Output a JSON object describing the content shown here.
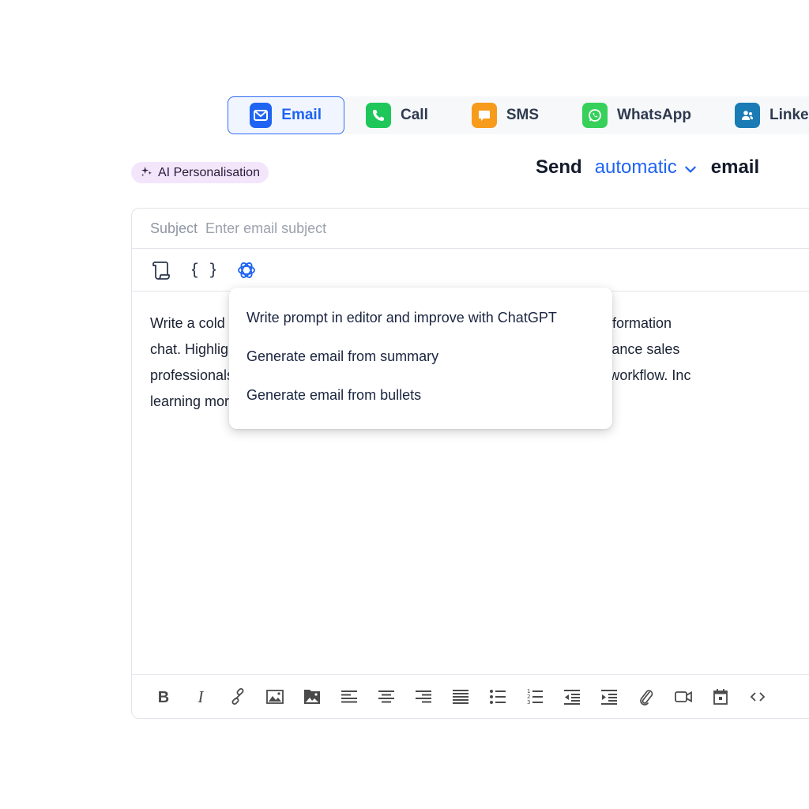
{
  "channels": {
    "tabs": [
      {
        "label": "Email",
        "icon": "mail-icon",
        "color": "#1f63f3",
        "active": true
      },
      {
        "label": "Call",
        "icon": "phone-icon",
        "color": "#1fc75b",
        "active": false
      },
      {
        "label": "SMS",
        "icon": "chat-bubble-icon",
        "color": "#f79b1c",
        "active": false
      },
      {
        "label": "WhatsApp",
        "icon": "whatsapp-icon",
        "color": "#36d05a",
        "active": false
      },
      {
        "label": "Linke",
        "icon": "users-icon",
        "color": "#1a7bb5",
        "active": false
      }
    ]
  },
  "ai_chip": {
    "label": "AI Personalisation",
    "icon": "sparkles-icon"
  },
  "send": {
    "prefix": "Send",
    "mode": "automatic",
    "suffix": "email",
    "accent": "#1e63f3"
  },
  "editor": {
    "subject_label": "Subject",
    "subject_placeholder": "Enter email subject",
    "subject_value": "",
    "top_tools": [
      {
        "name": "template-scroll-icon"
      },
      {
        "name": "variables-braces-icon",
        "text": "{ }"
      },
      {
        "name": "chatgpt-icon"
      }
    ],
    "body_lines": [
      "Write a cold email introducing a tool that automatically enriches contact information",
      "chat. Highlight how it helps save time, improve lead qualification, and enhance sales",
      "professionals' productivity. Encourage them to integrate it into their sales workflow. Inc",
      "learning more"
    ],
    "bottom_tools": [
      "bold-icon",
      "italic-icon",
      "link-icon",
      "image-icon",
      "image-folder-icon",
      "align-left-icon",
      "align-center-icon",
      "align-right-icon",
      "align-justify-icon",
      "bullet-list-icon",
      "numbered-list-icon",
      "outdent-icon",
      "indent-icon",
      "attachment-icon",
      "video-icon",
      "calendar-icon",
      "code-icon"
    ]
  },
  "ai_menu": {
    "items": [
      "Write prompt in editor and improve with ChatGPT",
      "Generate email from summary",
      "Generate email from bullets"
    ]
  }
}
